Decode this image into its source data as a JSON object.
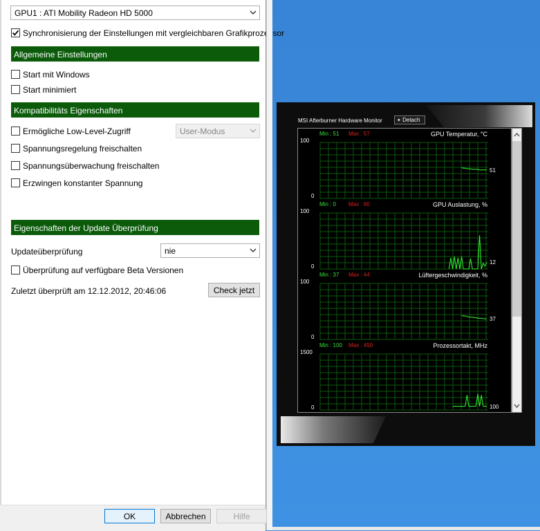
{
  "settings": {
    "gpu_select": "GPU1 : ATI Mobility Radeon HD 5000",
    "sync_label": "Synchronisierung der Einstellungen mit vergleichbaren Grafikprozessor",
    "sync_checked": true,
    "sections": {
      "general": "Allgemeine Einstellungen",
      "compat": "Kompatibilitäts Eigenschaften",
      "update": "Eigenschaften der Update Überprüfung"
    },
    "general_options": [
      {
        "label": "Start mit Windows",
        "checked": false
      },
      {
        "label": "Start minimiert",
        "checked": false
      }
    ],
    "compat_options": [
      {
        "label": "Ermögliche Low-Level-Zugriff",
        "checked": false
      },
      {
        "label": "Spannungsregelung freischalten",
        "checked": false
      },
      {
        "label": "Spannungsüberwachung freischalten",
        "checked": false
      },
      {
        "label": "Erzwingen konstanter Spannung",
        "checked": false
      }
    ],
    "low_level_mode": "User-Modus",
    "update_check_label": "Updateüberprüfung",
    "update_check_value": "nie",
    "beta_label": "Überprüfung auf verfügbare Beta Versionen",
    "beta_checked": false,
    "last_checked": "Zuletzt überprüft am 12.12.2012, 20:46:06",
    "check_now": "Check jetzt"
  },
  "footer": {
    "ok": "OK",
    "cancel": "Abbrechen",
    "help": "Hilfe"
  },
  "monitor": {
    "title": "MSI Afterburner Hardware Monitor",
    "detach": "Detach",
    "colors": {
      "min": "#3fe03f",
      "max": "#e02020",
      "line": "#33ff33",
      "grid": "#0d5a0d"
    },
    "graphs": [
      {
        "name": "GPU Temperatur, °C",
        "min_label": "Min : 51",
        "max_label": "Max : 57",
        "ymax": "100",
        "ymin": "0",
        "current": "51",
        "ylim": [
          0,
          100
        ],
        "samples": [
          55,
          54,
          54,
          53,
          53,
          53,
          52,
          52,
          52,
          52,
          51,
          51,
          51,
          51,
          51
        ]
      },
      {
        "name": "GPU Auslastung, %",
        "min_label": "Min : 0",
        "max_label": "Max : 60",
        "ymax": "100",
        "ymin": "0",
        "current": "12",
        "ylim": [
          0,
          100
        ],
        "samples": [
          0,
          20,
          0,
          22,
          0,
          20,
          0,
          22,
          0,
          0,
          0,
          0,
          18,
          0,
          0,
          0,
          0,
          60,
          0,
          10,
          5,
          12
        ]
      },
      {
        "name": "Lüftergeschwindigkeit, %",
        "min_label": "Min : 37",
        "max_label": "Max : 44",
        "ymax": "100",
        "ymin": "0",
        "current": "37",
        "ylim": [
          0,
          100
        ],
        "samples": [
          43,
          42,
          42,
          41,
          40,
          40,
          40,
          39,
          39,
          38,
          38,
          38,
          37,
          37,
          37
        ]
      },
      {
        "name": "Prozessortakt, MHz",
        "min_label": "Min : 100",
        "max_label": "Max : 450",
        "ymax": "1500",
        "ymin": "0",
        "current": "100",
        "ylim": [
          0,
          1500
        ],
        "samples": [
          100,
          100,
          100,
          100,
          100,
          100,
          100,
          100,
          400,
          100,
          100,
          100,
          100,
          100,
          430,
          100,
          400,
          100,
          100,
          100
        ]
      }
    ]
  }
}
